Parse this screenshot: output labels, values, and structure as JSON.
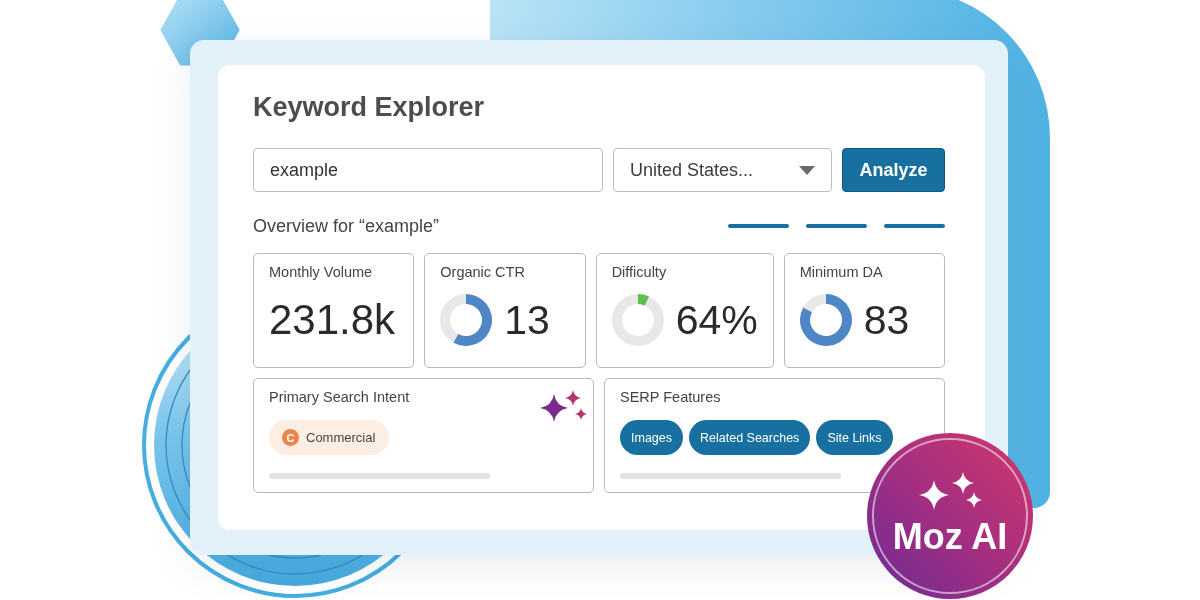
{
  "window": {
    "title": "Keyword Explorer"
  },
  "search": {
    "value": "example",
    "location": "United States...",
    "button": "Analyze"
  },
  "overview": {
    "title": "Overview for “example”"
  },
  "metrics": [
    {
      "kind": "number",
      "label": "Monthly Volume",
      "value": "231.8k"
    },
    {
      "kind": "gauge",
      "label": "Organic CTR",
      "value": "13",
      "color": "#4f86c6"
    },
    {
      "kind": "gauge",
      "label": "Difficulty",
      "value": "64%",
      "color": "#5bbf4a"
    },
    {
      "kind": "gauge",
      "label": "Minimum DA",
      "value": "83",
      "color": "#4f86c6"
    }
  ],
  "intent": {
    "title": "Primary Search Intent",
    "tag": {
      "letter": "C",
      "label": "Commercial"
    }
  },
  "serp_features": {
    "title": "SERP Features",
    "items": [
      "Images",
      "Related Searches",
      "Site Links"
    ]
  },
  "ai_badge": {
    "label": "Moz AI"
  }
}
